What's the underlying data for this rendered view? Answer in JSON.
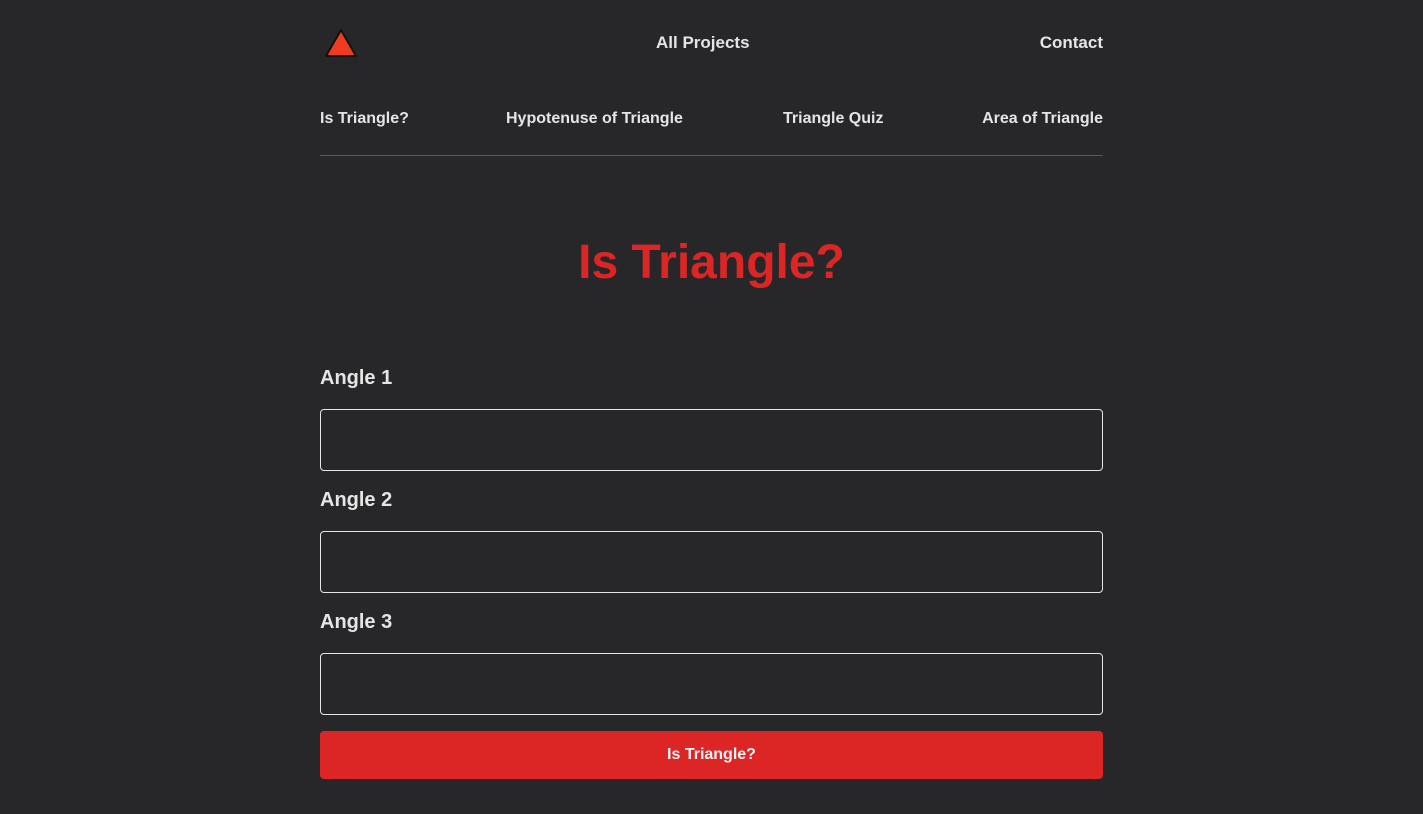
{
  "header": {
    "logo_icon": "triangle-logo-icon",
    "logo_color": "#f03c1e",
    "nav": {
      "all_projects": "All Projects",
      "contact": "Contact"
    }
  },
  "subnav": {
    "items": [
      {
        "label": "Is Triangle?"
      },
      {
        "label": "Hypotenuse of Triangle"
      },
      {
        "label": "Triangle Quiz"
      },
      {
        "label": "Area of Triangle"
      }
    ]
  },
  "main": {
    "title": "Is Triangle?",
    "fields": [
      {
        "label": "Angle 1",
        "value": ""
      },
      {
        "label": "Angle 2",
        "value": ""
      },
      {
        "label": "Angle 3",
        "value": ""
      }
    ],
    "submit_label": "Is Triangle?"
  },
  "colors": {
    "background": "#27272a",
    "accent": "#dc2626",
    "text": "#e5e5e5"
  }
}
